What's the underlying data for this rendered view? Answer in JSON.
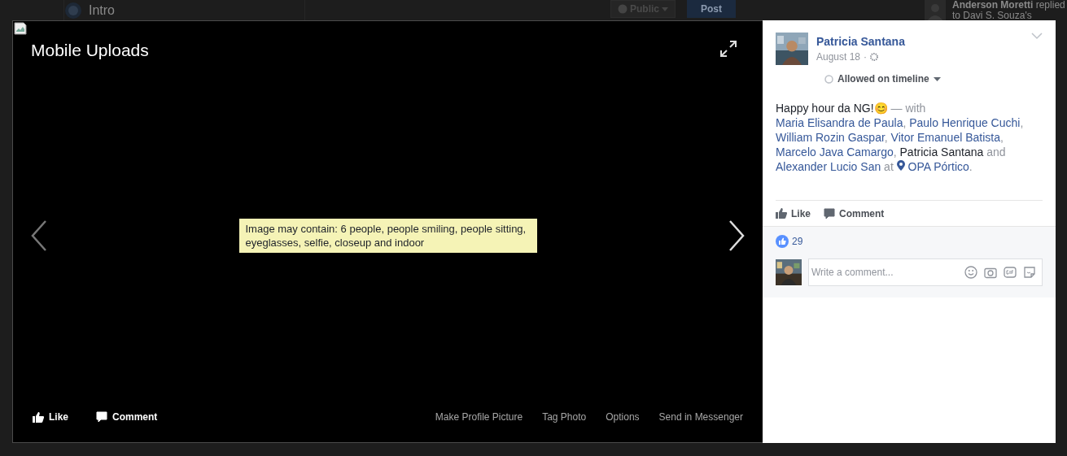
{
  "background_page": {
    "section_title": "Intro",
    "audience_button": "Public",
    "post_button": "Post",
    "notification": {
      "name": "Anderson Moretti",
      "action": "replied",
      "detail": "to Davi S. Souza's"
    }
  },
  "viewer": {
    "album_title": "Mobile Uploads",
    "alt_text": "Image may contain: 6 people, people smiling, people sitting, eyeglasses, selfie, closeup and indoor",
    "actions": [
      {
        "kind": "like",
        "label": "Like"
      },
      {
        "kind": "comment",
        "label": "Comment"
      }
    ],
    "links": [
      "Make Profile Picture",
      "Tag Photo",
      "Options",
      "Send in Messenger"
    ]
  },
  "post": {
    "author": "Patricia Santana",
    "date": "August 18",
    "separator": "·",
    "privacy": "Allowed on timeline",
    "message": [
      {
        "kind": "plain",
        "text": "Happy hour da NG!😊"
      },
      {
        "kind": "muted",
        "text": " — with "
      },
      {
        "kind": "link",
        "text": "Maria Elisandra de Paula"
      },
      {
        "kind": "muted",
        "text": ", "
      },
      {
        "kind": "link",
        "text": "Paulo Henrique Cuchi"
      },
      {
        "kind": "muted",
        "text": ", "
      },
      {
        "kind": "link",
        "text": "William Rozin Gaspar"
      },
      {
        "kind": "muted",
        "text": ", "
      },
      {
        "kind": "link",
        "text": "Vitor Emanuel Batista"
      },
      {
        "kind": "muted",
        "text": ", "
      },
      {
        "kind": "link",
        "text": "Marcelo Java Camargo"
      },
      {
        "kind": "muted",
        "text": ", "
      },
      {
        "kind": "plain",
        "text": "Patricia Santana"
      },
      {
        "kind": "muted",
        "text": " and "
      },
      {
        "kind": "link",
        "text": "Alexander Lucio San"
      },
      {
        "kind": "muted",
        "text": " at "
      },
      {
        "kind": "place",
        "text": "OPA Pórtico"
      },
      {
        "kind": "muted",
        "text": "."
      }
    ],
    "actions": [
      {
        "kind": "like",
        "label": "Like"
      },
      {
        "kind": "comment",
        "label": "Comment"
      }
    ],
    "like_count": "29",
    "comment_placeholder": "Write a comment..."
  }
}
